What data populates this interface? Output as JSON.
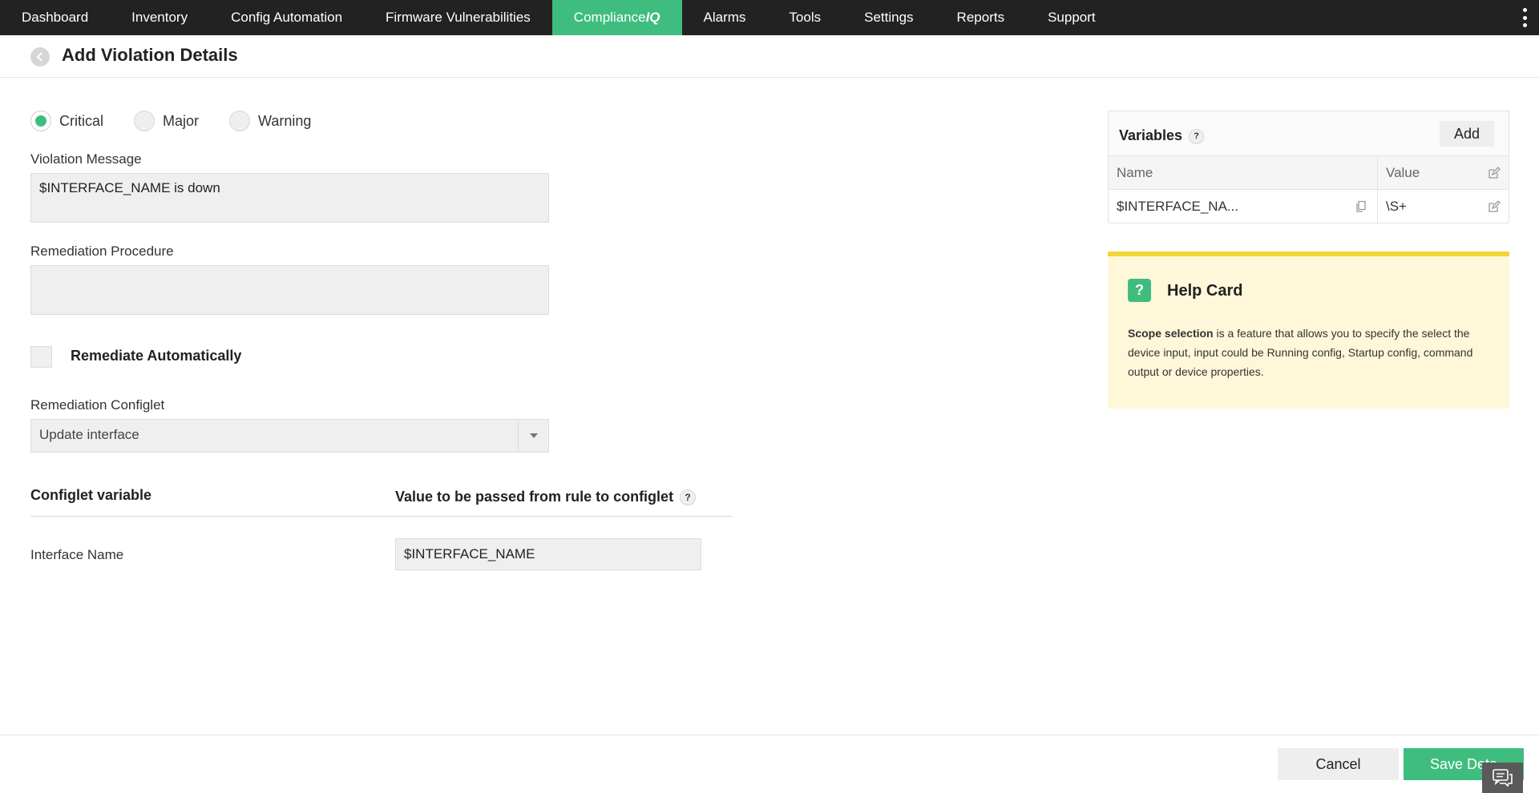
{
  "nav": {
    "items": [
      {
        "label": "Dashboard"
      },
      {
        "label": "Inventory"
      },
      {
        "label": "Config Automation"
      },
      {
        "label": "Firmware Vulnerabilities"
      },
      {
        "label": "Compliance",
        "suffix": "IQ",
        "active": true
      },
      {
        "label": "Alarms"
      },
      {
        "label": "Tools"
      },
      {
        "label": "Settings"
      },
      {
        "label": "Reports"
      },
      {
        "label": "Support"
      }
    ]
  },
  "header": {
    "title": "Add Violation Details"
  },
  "severity": {
    "options": [
      "Critical",
      "Major",
      "Warning"
    ],
    "selected": "Critical"
  },
  "form": {
    "violation_message_label": "Violation Message",
    "violation_message_value": "$INTERFACE_NAME is down",
    "remediation_procedure_label": "Remediation Procedure",
    "remediation_procedure_value": "",
    "remediate_auto_label": "Remediate Automatically",
    "remediation_configlet_label": "Remediation Configlet",
    "remediation_configlet_value": "Update interface"
  },
  "configlet": {
    "col_variable": "Configlet variable",
    "col_value": "Value to be passed from rule to configlet",
    "rows": [
      {
        "name": "Interface Name",
        "value": "$INTERFACE_NAME"
      }
    ]
  },
  "variables": {
    "title": "Variables",
    "add_label": "Add",
    "col_name": "Name",
    "col_value": "Value",
    "rows": [
      {
        "name": "$INTERFACE_NA...",
        "value": "\\S+"
      }
    ]
  },
  "help_card": {
    "title": "Help Card",
    "icon_text": "?",
    "bold_text": "Scope selection",
    "text": " is a feature that allows you to specify the select the device input, input could be Running config, Startup config, command output or device properties."
  },
  "footer": {
    "cancel_label": "Cancel",
    "save_label": "Save Deta"
  },
  "colors": {
    "accent": "#3fbd7f",
    "nav_bg": "#222222",
    "help_card_bg": "#fff7d9",
    "help_card_border": "#f5d535"
  }
}
